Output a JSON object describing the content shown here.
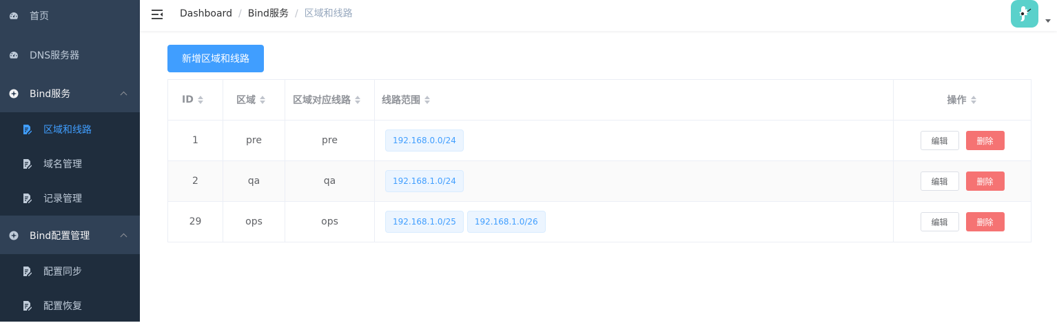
{
  "sidebar": {
    "items": [
      {
        "label": "首页",
        "icon": "dashboard-icon"
      },
      {
        "label": "DNS服务器",
        "icon": "dashboard-icon"
      },
      {
        "label": "Bind服务",
        "icon": "compass-icon",
        "expanded": true,
        "children": [
          {
            "label": "区域和线路",
            "active": true
          },
          {
            "label": "域名管理"
          },
          {
            "label": "记录管理"
          }
        ]
      },
      {
        "label": "Bind配置管理",
        "icon": "compass-icon",
        "expanded": true,
        "children": [
          {
            "label": "配置同步"
          },
          {
            "label": "配置恢复"
          }
        ]
      }
    ],
    "bg_color": "#304156",
    "submenu_bg_color": "#1f2d3d",
    "active_color": "#409eff"
  },
  "header": {
    "breadcrumb": [
      "Dashboard",
      "Bind服务",
      "区域和线路"
    ]
  },
  "main": {
    "add_button": "新增区域和线路",
    "table": {
      "columns": [
        "ID",
        "区域",
        "区域对应线路",
        "线路范围",
        "操作"
      ],
      "rows": [
        {
          "id": "1",
          "zone": "pre",
          "line": "pre",
          "ranges": [
            "192.168.0.0/24"
          ]
        },
        {
          "id": "2",
          "zone": "qa",
          "line": "qa",
          "ranges": [
            "192.168.1.0/24"
          ]
        },
        {
          "id": "29",
          "zone": "ops",
          "line": "ops",
          "ranges": [
            "192.168.1.0/25",
            "192.168.1.0/26"
          ]
        }
      ],
      "edit_label": "编辑",
      "delete_label": "删除"
    },
    "accent_color": "#409eff",
    "danger_color": "#f56c6c"
  }
}
